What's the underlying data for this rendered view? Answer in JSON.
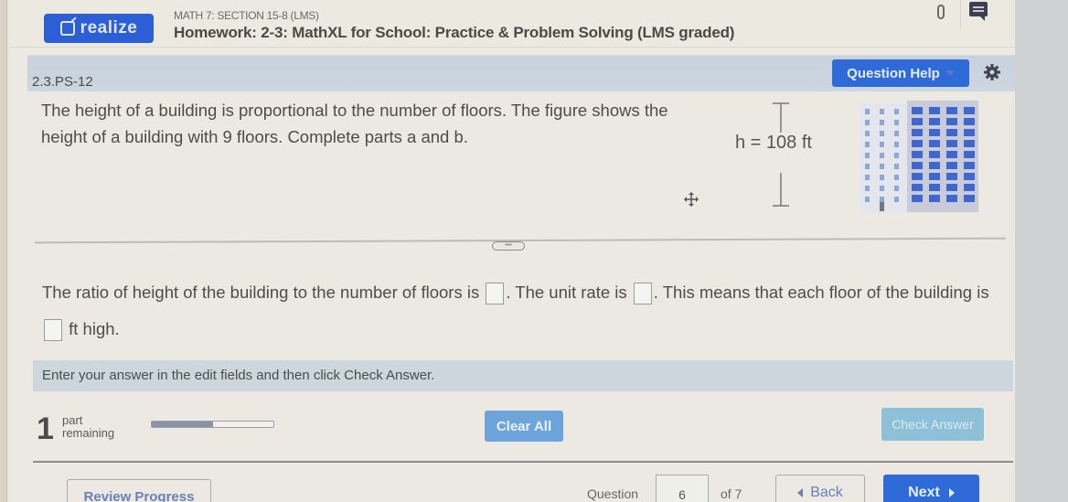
{
  "header": {
    "brand_label": "realize",
    "course": "MATH 7: SECTION 15-8 (LMS)",
    "title": "Homework: 2-3: MathXL for School: Practice & Problem Solving (LMS graded)",
    "icons": [
      "external-link-icon",
      "paperclip-icon",
      "chat-icon"
    ]
  },
  "question_bar": {
    "question_id": "2.3.PS-12",
    "help_label": "Question Help",
    "icons": [
      "caret-down-icon",
      "gear-icon"
    ]
  },
  "problem": {
    "text": "The height of a building is proportional to the number of floors. The figure shows the height of a building with 9 floors. Complete parts a and b.",
    "figure_label": "h = 108 ft",
    "figure_floors": 9
  },
  "answer": {
    "part1": "The ratio of height of the building to the number of floors is",
    "part2": ". The unit rate is",
    "part3": ". This means that each floor of the building is",
    "part4": "ft high.",
    "box_values": [
      "",
      "",
      ""
    ]
  },
  "instructions": "Enter your answer in the edit fields and then click Check Answer.",
  "status": {
    "parts_count": "1",
    "parts_word": "part",
    "remaining_word": "remaining",
    "progress_fraction": 0.5
  },
  "actions": {
    "clear_all": "Clear All",
    "check_answer": "Check Answer"
  },
  "footer": {
    "review_progress": "Review Progress",
    "question_label": "Question",
    "question_number": "6",
    "of_total": "of 7",
    "back_label": "Back",
    "next_label": "Next"
  }
}
